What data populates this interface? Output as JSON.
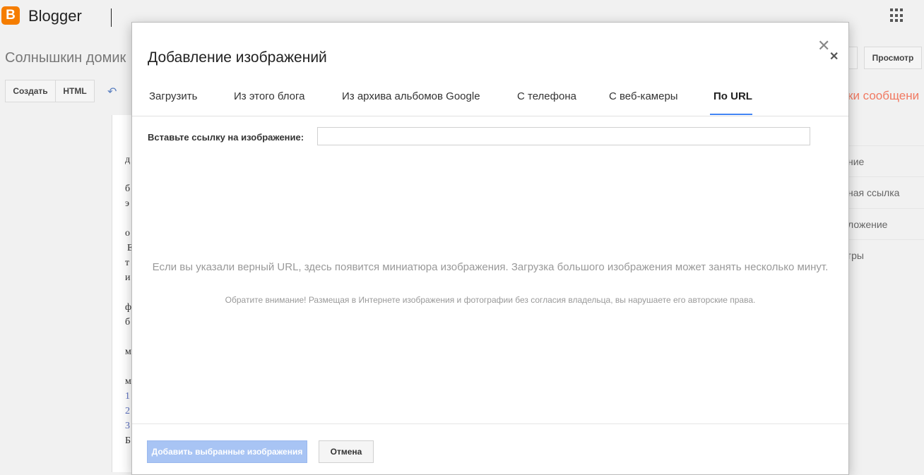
{
  "app": {
    "brand": "Blogger",
    "logo_letter": "B"
  },
  "blog": {
    "title": "Солнышкин домик"
  },
  "toolbar": {
    "compose_label": "Создать",
    "html_label": "HTML",
    "undo_icon": "undo-icon",
    "preview_label": "Просмотр"
  },
  "right_panel": {
    "link": "ки сообщени",
    "items": [
      "ние",
      "ная ссылка",
      "ложение",
      "гры"
    ]
  },
  "editor": {
    "lines": [
      "д",
      "б",
      "э",
      "о",
      "Е",
      "т",
      "и",
      "ф",
      "б",
      "м",
      "м",
      "1",
      "2",
      "3",
      "Б"
    ]
  },
  "dialog": {
    "title": "Добавление изображений",
    "tabs": [
      {
        "label": "Загрузить"
      },
      {
        "label": "Из этого блога"
      },
      {
        "label": "Из архива альбомов Google"
      },
      {
        "label": "С телефона"
      },
      {
        "label": "С веб-камеры"
      },
      {
        "label": "По URL",
        "active": true
      }
    ],
    "url_label": "Вставьте ссылку на изображение:",
    "url_value": "",
    "hint": "Если вы указали верный URL, здесь появится миниатюра изображения. Загрузка большого изображения может занять несколько минут.",
    "note": "Обратите внимание! Размещая в Интернете изображения и фотографии без согласия владельца, вы нарушаете его авторские права.",
    "add_button": "Добавить выбранные изображения",
    "cancel_button": "Отмена"
  },
  "colors": {
    "accent": "#4285f4",
    "brand": "#f57d00",
    "add_button_disabled": "#a8c4f4"
  }
}
